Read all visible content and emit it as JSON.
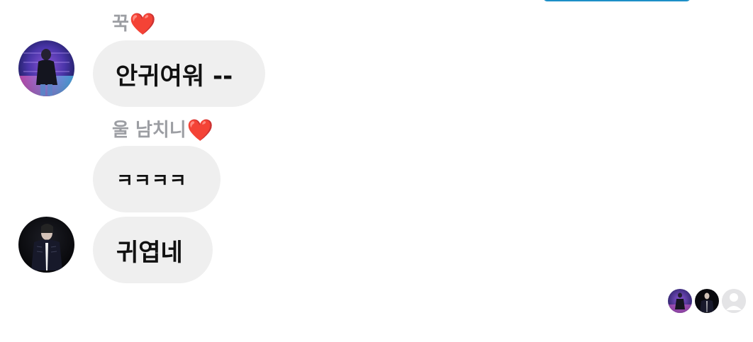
{
  "messages": [
    {
      "sender": "꾹",
      "sender_emoji": "❤️",
      "text": "안귀여워 --"
    },
    {
      "sender": "울 남치니",
      "sender_emoji": "❤️",
      "text_1": "ㅋㅋㅋㅋ",
      "text_2": "귀엽네"
    }
  ],
  "colors": {
    "bubble": "#efefef",
    "sender_name": "#9c9ea3",
    "heart": "#e8132b",
    "top_accent": "#1d8fc7"
  },
  "icons": {
    "avatar_1": "concert-stage-person-avatar",
    "avatar_2": "dark-jacket-person-avatar",
    "heart": "red-heart-emoji",
    "read_receipt_3": "blank-user-avatar"
  }
}
